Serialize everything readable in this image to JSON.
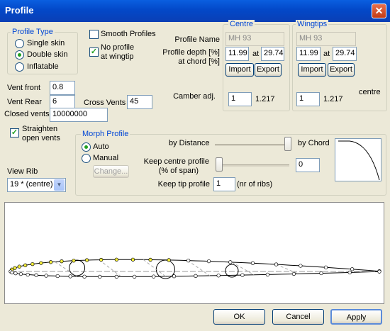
{
  "window": {
    "title": "Profile",
    "close_glyph": "✕"
  },
  "profile_type": {
    "legend": "Profile Type",
    "options": [
      "Single skin",
      "Double skin",
      "Inflatable"
    ],
    "selected": "Double skin"
  },
  "smooth_profiles": {
    "label": "Smooth Profiles",
    "checked": false
  },
  "no_profile_wingtip": {
    "label_line1": "No profile",
    "label_line2": "at wingtip",
    "checked": true
  },
  "fields": {
    "profile_name_label": "Profile Name",
    "profile_depth_label_line1": "Profile depth [%]",
    "profile_depth_label_line2": "at chord [%]",
    "camber_label": "Camber adj."
  },
  "centre": {
    "legend": "Centre",
    "name": "MH 93",
    "depth": "11.99",
    "at_label": "at",
    "chord": "29.74",
    "import_label": "Import",
    "export_label": "Export",
    "camber": "1",
    "camber_value": "1.217"
  },
  "wingtips": {
    "legend": "Wingtips",
    "name": "MH 93",
    "depth": "11.99",
    "at_label": "at",
    "chord": "29.74",
    "import_label": "Import",
    "export_label": "Export",
    "camber": "1",
    "camber_value": "1.217",
    "centre_label": "centre"
  },
  "vents": {
    "front_label": "Vent front",
    "front_value": "0.8",
    "rear_label": "Vent Rear",
    "rear_value": "6",
    "cross_label": "Cross Vents",
    "cross_value": "45",
    "closed_label": "Closed vents",
    "closed_value": "10000000"
  },
  "straighten": {
    "label_line1": "Straighten",
    "label_line2": "open vents",
    "checked": true
  },
  "view_rib": {
    "label": "View Rib",
    "value": "19 * (centre)"
  },
  "morph": {
    "legend": "Morph Profile",
    "auto_label": "Auto",
    "manual_label": "Manual",
    "selected": "Auto",
    "change_label": "Change...",
    "by_distance_label": "by Distance",
    "by_chord_label": "by Chord",
    "distance_chord_ratio": 1.0,
    "keep_centre_label_line1": "Keep centre profile",
    "keep_centre_label_line2": "(% of span)",
    "keep_centre_value": "0",
    "keep_centre_slider": 0.0,
    "keep_tip_label": "Keep tip profile",
    "keep_tip_value": "1",
    "keep_tip_unit": "(nr of ribs)"
  },
  "footer": {
    "ok_label": "OK",
    "cancel_label": "Cancel",
    "apply_label": "Apply"
  }
}
